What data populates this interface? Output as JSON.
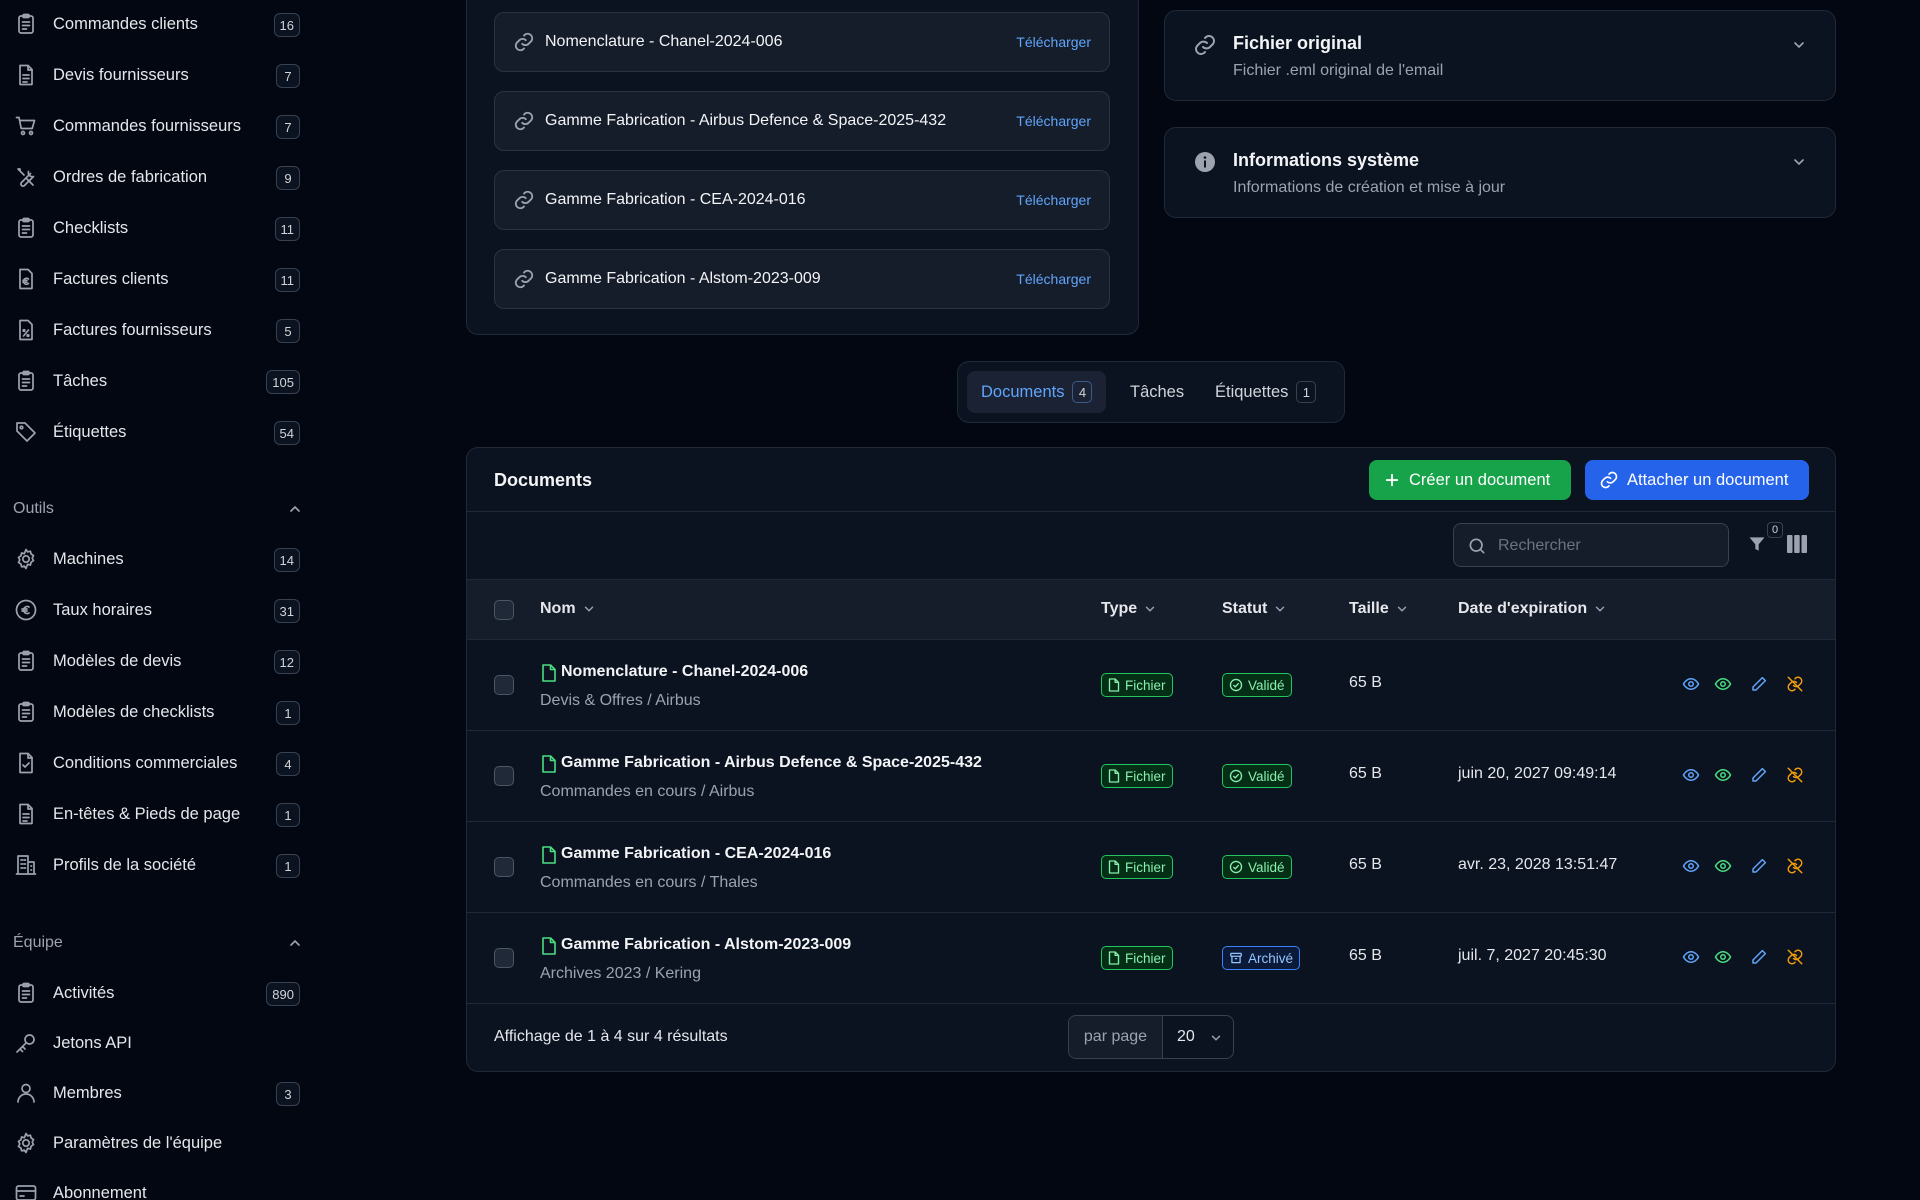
{
  "sidebar": {
    "items_top": [
      {
        "label": "Commandes clients",
        "count": "16",
        "icon": "clipboard-icon"
      },
      {
        "label": "Devis fournisseurs",
        "count": "7",
        "icon": "document-icon"
      },
      {
        "label": "Commandes fournisseurs",
        "count": "7",
        "icon": "cart-icon"
      },
      {
        "label": "Ordres de fabrication",
        "count": "9",
        "icon": "tools-icon"
      },
      {
        "label": "Checklists",
        "count": "11",
        "icon": "clipboard-icon"
      },
      {
        "label": "Factures clients",
        "count": "11",
        "icon": "euro-document-icon"
      },
      {
        "label": "Factures fournisseurs",
        "count": "5",
        "icon": "percent-document-icon"
      },
      {
        "label": "Tâches",
        "count": "105",
        "icon": "clipboard-icon"
      },
      {
        "label": "Étiquettes",
        "count": "54",
        "icon": "tag-icon"
      }
    ],
    "group_outils": {
      "title": "Outils",
      "items": [
        {
          "label": "Machines",
          "count": "14",
          "icon": "gear-icon"
        },
        {
          "label": "Taux horaires",
          "count": "31",
          "icon": "euro-circle-icon"
        },
        {
          "label": "Modèles de devis",
          "count": "12",
          "icon": "clipboard-icon"
        },
        {
          "label": "Modèles de checklists",
          "count": "1",
          "icon": "clipboard-icon"
        },
        {
          "label": "Conditions commerciales",
          "count": "4",
          "icon": "document-check-icon"
        },
        {
          "label": "En-têtes & Pieds de page",
          "count": "1",
          "icon": "document-icon"
        },
        {
          "label": "Profils de la société",
          "count": "1",
          "icon": "building-icon"
        }
      ]
    },
    "group_equipe": {
      "title": "Équipe",
      "items": [
        {
          "label": "Activités",
          "count": "890",
          "icon": "clipboard-icon"
        },
        {
          "label": "Jetons API",
          "count": "",
          "icon": "key-icon"
        },
        {
          "label": "Membres",
          "count": "3",
          "icon": "user-icon"
        },
        {
          "label": "Paramètres de l'équipe",
          "count": "",
          "icon": "gear-icon"
        },
        {
          "label": "Abonnement",
          "count": "",
          "icon": "credit-card-icon"
        }
      ]
    }
  },
  "attachments": [
    {
      "name": "Nomenclature - Chanel-2024-006",
      "action": "Télécharger"
    },
    {
      "name": "Gamme Fabrication - Airbus Defence & Space-2025-432",
      "action": "Télécharger"
    },
    {
      "name": "Gamme Fabrication - CEA-2024-016",
      "action": "Télécharger"
    },
    {
      "name": "Gamme Fabrication - Alstom-2023-009",
      "action": "Télécharger"
    }
  ],
  "info_cards": {
    "original": {
      "title": "Fichier original",
      "desc": "Fichier .eml original de l'email",
      "icon": "link-icon"
    },
    "system": {
      "title": "Informations système",
      "desc": "Informations de création et mise à jour",
      "icon": "info-icon"
    }
  },
  "tabs": [
    {
      "label": "Documents",
      "count": "4",
      "active": true
    },
    {
      "label": "Tâches",
      "count": "",
      "active": false
    },
    {
      "label": "Étiquettes",
      "count": "1",
      "active": false
    }
  ],
  "documents": {
    "title": "Documents",
    "create_label": "Créer un document",
    "attach_label": "Attacher un document",
    "search_placeholder": "Rechercher",
    "filter_count": "0",
    "columns": {
      "name": "Nom",
      "type": "Type",
      "status": "Statut",
      "size": "Taille",
      "expiry": "Date d'expiration"
    },
    "rows": [
      {
        "name": "Nomenclature - Chanel-2024-006",
        "path": "Devis & Offres / Airbus",
        "type": "Fichier",
        "status": "Validé",
        "status_kind": "ok",
        "size": "65 B",
        "expiry": ""
      },
      {
        "name": "Gamme Fabrication - Airbus Defence & Space-2025-432",
        "path": "Commandes en cours / Airbus",
        "type": "Fichier",
        "status": "Validé",
        "status_kind": "ok",
        "size": "65 B",
        "expiry": "juin 20, 2027 09:49:14"
      },
      {
        "name": "Gamme Fabrication - CEA-2024-016",
        "path": "Commandes en cours / Thales",
        "type": "Fichier",
        "status": "Validé",
        "status_kind": "ok",
        "size": "65 B",
        "expiry": "avr. 23, 2028 13:51:47"
      },
      {
        "name": "Gamme Fabrication - Alstom-2023-009",
        "path": "Archives 2023 / Kering",
        "type": "Fichier",
        "status": "Archivé",
        "status_kind": "archived",
        "size": "65 B",
        "expiry": "juil. 7, 2027 20:45:30"
      }
    ],
    "summary": "Affichage de 1 à 4 sur 4 résultats",
    "per_page_label": "par page",
    "per_page_value": "20"
  },
  "colors": {
    "accent_blue": "#2563eb",
    "accent_green": "#16a34a",
    "link_blue": "#60a5fa",
    "background": "#030712"
  }
}
